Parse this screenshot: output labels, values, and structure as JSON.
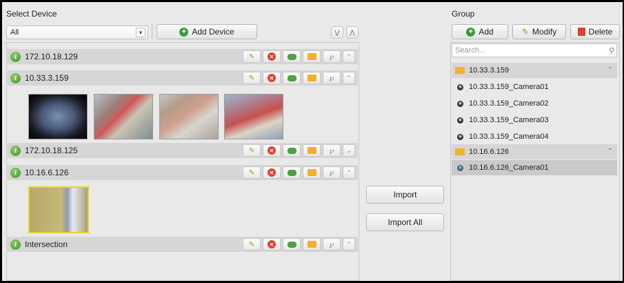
{
  "left": {
    "title": "Select Device",
    "filter_value": "All",
    "add_device_label": "Add Device",
    "devices": [
      {
        "name": "172.10.18.129"
      },
      {
        "name": "10.33.3.159"
      },
      {
        "name": "172.10.18.125"
      },
      {
        "name": "10.16.6.126"
      },
      {
        "name": "Intersection"
      }
    ]
  },
  "middle": {
    "import_label": "Import",
    "import_all_label": "Import All"
  },
  "right": {
    "title": "Group",
    "add_label": "Add",
    "modify_label": "Modify",
    "delete_label": "Delete",
    "search_placeholder": "Search...",
    "groups": [
      {
        "name": "10.33.3.159",
        "cameras": [
          "10.33.3.159_Camera01",
          "10.33.3.159_Camera02",
          "10.33.3.159_Camera03",
          "10.33.3.159_Camera04"
        ]
      },
      {
        "name": "10.16.6.126",
        "cameras": [
          "10.16.6.126_Camera01"
        ]
      }
    ]
  },
  "icons": {
    "add": "circle-plus-icon",
    "edit": "pencil-icon",
    "delete": "x-circle-icon",
    "link": "link-icon",
    "folder": "folder-icon",
    "config": "wrench-icon",
    "collapse": "chevron-up-icon",
    "expand": "chevron-down-icon",
    "search": "search-icon",
    "info": "info-icon",
    "camera": "camera-icon"
  },
  "colors": {
    "panel_bg": "#e9e9e9",
    "row_bg": "#d6d6d6",
    "add_green": "#3c9a3c",
    "delete_red": "#e04030",
    "folder_yellow": "#f2b12a"
  }
}
